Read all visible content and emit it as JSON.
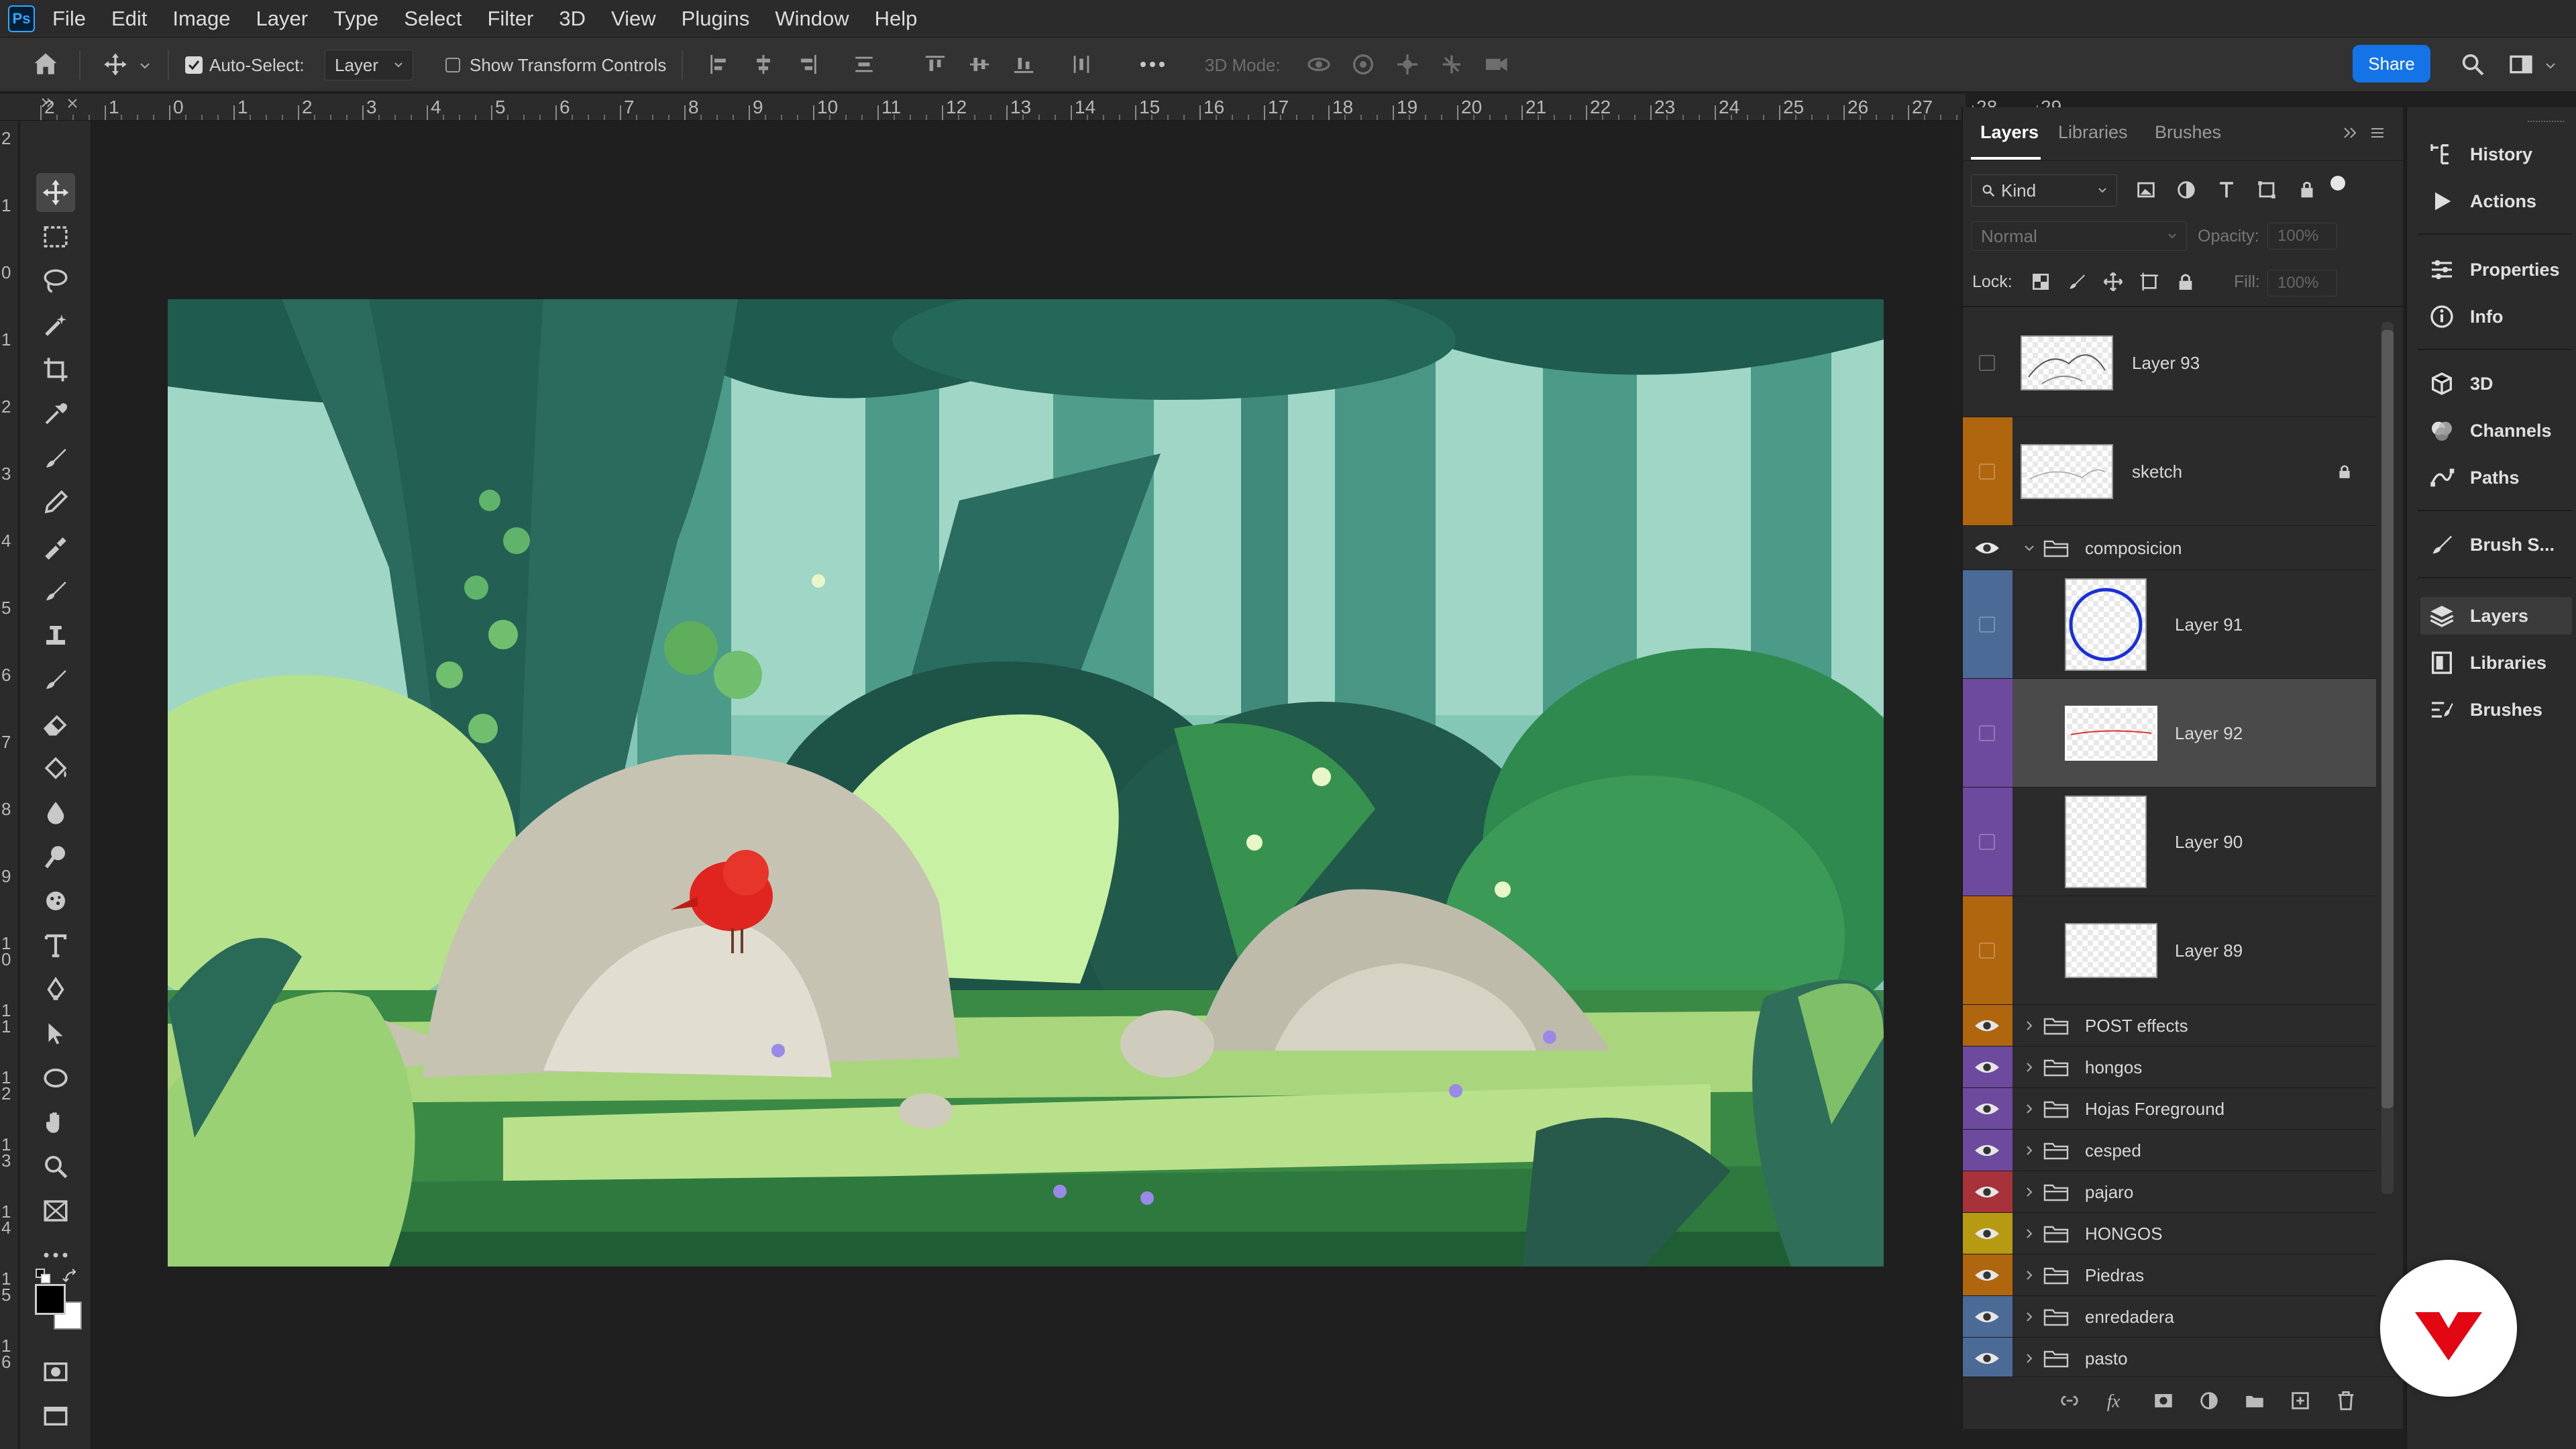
{
  "app": {
    "logo": "Ps"
  },
  "menu": [
    "File",
    "Edit",
    "Image",
    "Layer",
    "Type",
    "Select",
    "Filter",
    "3D",
    "View",
    "Plugins",
    "Window",
    "Help"
  ],
  "options": {
    "auto_select_label": "Auto-Select:",
    "auto_select_checked": true,
    "auto_select_target": "Layer",
    "transform_controls_label": "Show Transform Controls",
    "transform_controls_checked": false,
    "mode_3d_label": "3D Mode:",
    "share_label": "Share"
  },
  "ruler_top": [
    "2",
    "1",
    "0",
    "1",
    "2",
    "3",
    "4",
    "5",
    "6",
    "7",
    "8",
    "9",
    "10",
    "11",
    "12",
    "13",
    "14",
    "15",
    "16",
    "17",
    "18",
    "19",
    "20",
    "21",
    "22",
    "23",
    "24",
    "25",
    "26",
    "27",
    "28",
    "29"
  ],
  "ruler_left": [
    "2",
    "1",
    "0",
    "1",
    "2",
    "3",
    "4",
    "5",
    "6",
    "7",
    "8",
    "9",
    "1\n0",
    "1\n1",
    "1\n2",
    "1\n3",
    "1\n4",
    "1\n5",
    "1\n6"
  ],
  "layers_panel": {
    "tabs": [
      "Layers",
      "Libraries",
      "Brushes"
    ],
    "active_tab": "Layers",
    "filter_kind": "Kind",
    "blend_mode": "Normal",
    "opacity_label": "Opacity:",
    "opacity_value": "100%",
    "lock_label": "Lock:",
    "fill_label": "Fill:",
    "fill_value": "100%",
    "layers": [
      {
        "name": "Layer 93",
        "color": "#2b2b2b",
        "visible": false
      },
      {
        "name": "sketch",
        "color": "#b0650f",
        "visible": false,
        "locked": true
      },
      {
        "name": "composicion",
        "color": "#2b2b2b",
        "visible": true,
        "group": true,
        "expanded": true
      },
      {
        "name": "Layer 91",
        "color": "#4c6a96",
        "visible": false
      },
      {
        "name": "Layer 92",
        "color": "#6e4a9e",
        "visible": false,
        "selected": true
      },
      {
        "name": "Layer 90",
        "color": "#6e4a9e",
        "visible": false
      },
      {
        "name": "Layer 89",
        "color": "#b0650f",
        "visible": false
      },
      {
        "name": "POST effects",
        "color": "#b0650f",
        "visible": true,
        "group": true
      },
      {
        "name": "hongos",
        "color": "#6e4a9e",
        "visible": true,
        "group": true
      },
      {
        "name": "Hojas Foreground",
        "color": "#6e4a9e",
        "visible": true,
        "group": true
      },
      {
        "name": "cesped",
        "color": "#6e4a9e",
        "visible": true,
        "group": true
      },
      {
        "name": "pajaro",
        "color": "#a8323a",
        "visible": true,
        "group": true
      },
      {
        "name": "HONGOS",
        "color": "#b69a12",
        "visible": true,
        "group": true
      },
      {
        "name": "Piedras",
        "color": "#b0650f",
        "visible": true,
        "group": true
      },
      {
        "name": "enredadera",
        "color": "#4c6a96",
        "visible": true,
        "group": true
      },
      {
        "name": "pasto",
        "color": "#4c6a96",
        "visible": true,
        "group": true
      }
    ]
  },
  "dock": {
    "items": [
      "History",
      "Actions",
      "Properties",
      "Info",
      "3D",
      "Channels",
      "Paths",
      "Brush S...",
      "Layers",
      "Libraries",
      "Brushes"
    ],
    "active": "Layers"
  }
}
